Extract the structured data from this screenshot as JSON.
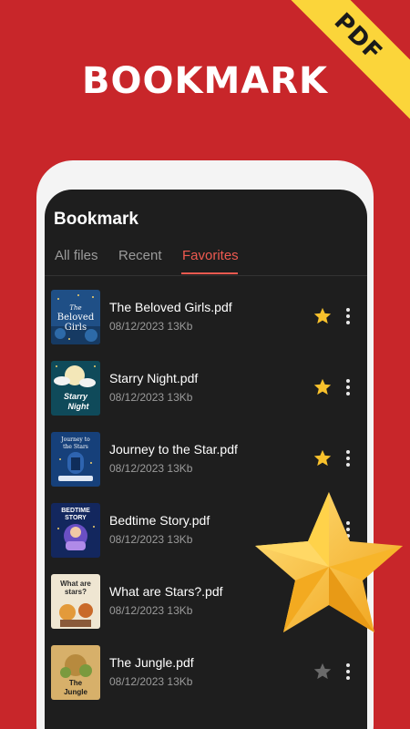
{
  "ribbon": {
    "label": "PDF"
  },
  "headline": "BOOKMARK",
  "app": {
    "title": "Bookmark"
  },
  "tabs": [
    {
      "label": "All files",
      "active": false
    },
    {
      "label": "Recent",
      "active": false
    },
    {
      "label": "Favorites",
      "active": true
    }
  ],
  "files": [
    {
      "name": "The Beloved Girls.pdf",
      "meta": "08/12/2023 13Kb",
      "favorite": true,
      "cover_title": "The Beloved Girls"
    },
    {
      "name": "Starry Night.pdf",
      "meta": "08/12/2023 13Kb",
      "favorite": true,
      "cover_title": "Starry Night"
    },
    {
      "name": "Journey to the Star.pdf",
      "meta": "08/12/2023 13Kb",
      "favorite": true,
      "cover_title": "Journey to the Stars"
    },
    {
      "name": "Bedtime Story.pdf",
      "meta": "08/12/2023 13Kb",
      "favorite": true,
      "cover_title": "BEDTIME STORY"
    },
    {
      "name": "What are Stars?.pdf",
      "meta": "08/12/2023 13Kb",
      "favorite": true,
      "cover_title": "What are stars?"
    },
    {
      "name": "The Jungle.pdf",
      "meta": "08/12/2023 13Kb",
      "favorite": false,
      "cover_title": "The Jungle"
    }
  ],
  "colors": {
    "background": "#c8262a",
    "accent": "#ef5a50",
    "star_active": "#f8c12c",
    "star_inactive": "#6a6a6a"
  }
}
